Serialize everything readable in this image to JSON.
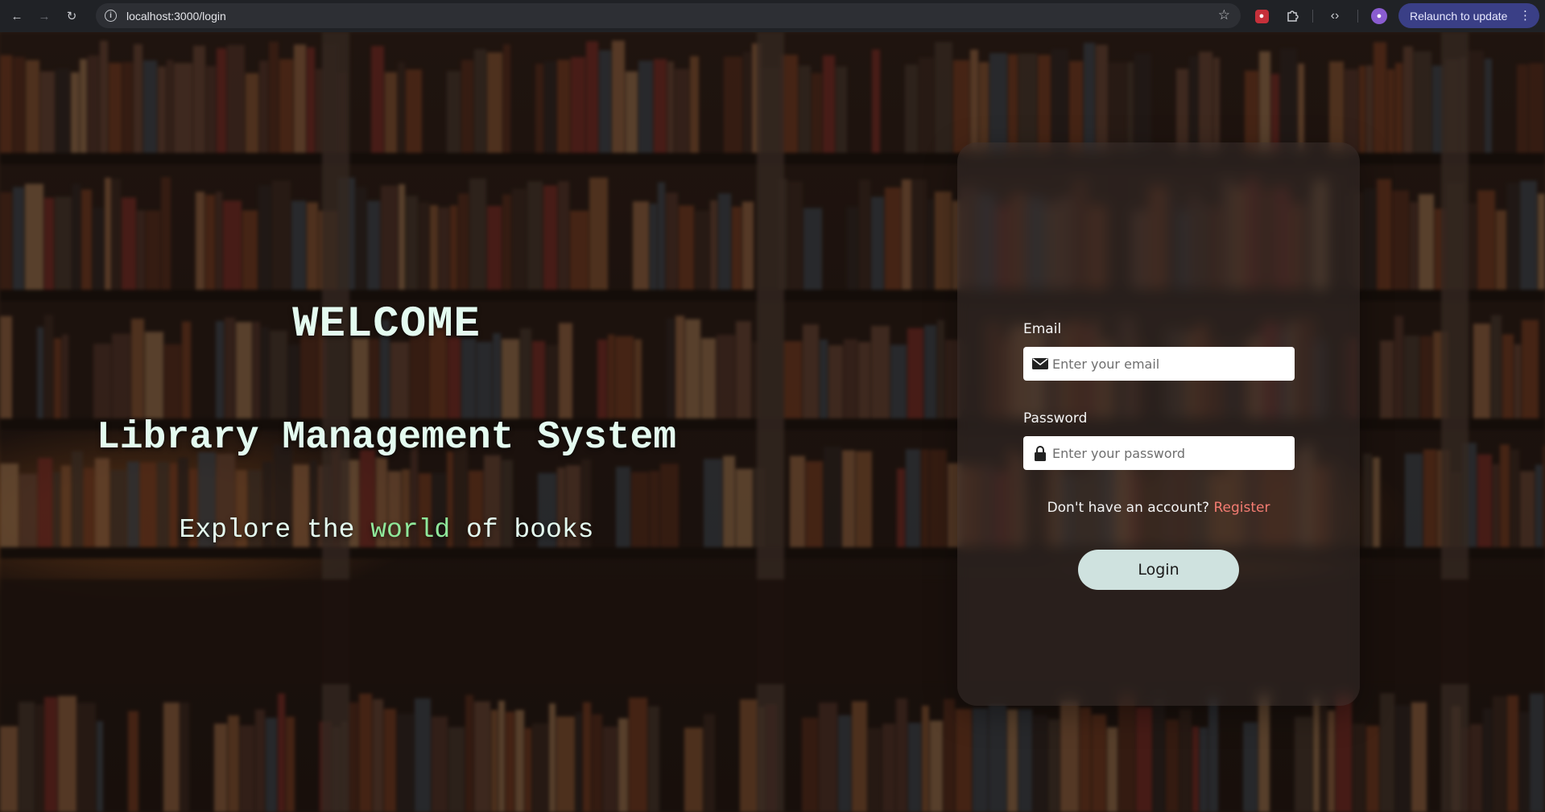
{
  "browser": {
    "url": "localhost:3000/login",
    "relaunch_label": "Relaunch to update",
    "icons": {
      "back": "back-arrow-icon",
      "forward": "forward-arrow-icon",
      "reload": "reload-icon",
      "site_info": "site-info-icon",
      "bookmark": "star-icon",
      "extension": "extension-icon",
      "puzzle": "puzzle-icon",
      "devtools": "code-icon",
      "profile": "profile-icon",
      "menu": "kebab-menu-icon"
    }
  },
  "hero": {
    "title": "WELCOME",
    "subtitle": "Library Management System",
    "tagline_before": "Explore the ",
    "tagline_accent": "world",
    "tagline_after": " of books"
  },
  "login": {
    "email_label": "Email",
    "email_placeholder": "Enter your email",
    "password_label": "Password",
    "password_placeholder": "Enter your password",
    "register_prompt": "Don't have an account?",
    "register_link": "Register",
    "login_button": "Login"
  },
  "colors": {
    "hero_text": "#e4fbf0",
    "tagline_accent": "#8fe89a",
    "register_link": "#f47c72",
    "login_button_bg": "#cfe2df",
    "relaunch_bg": "#3a3f86"
  }
}
